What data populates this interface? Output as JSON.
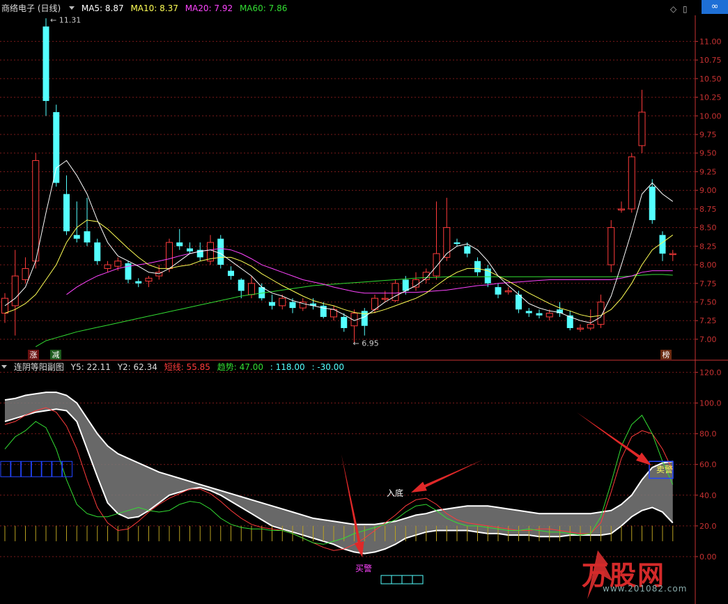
{
  "header": {
    "title": "商络电子 (日线)",
    "ma5": "MA5: 8.87",
    "ma10": "MA10: 8.37",
    "ma20": "MA20: 7.92",
    "ma60": "MA60: 7.86"
  },
  "sub_header": {
    "title": "连阴等阳副图",
    "y5": "Y5: 22.11",
    "y2": "Y2: 62.34",
    "short": "短线: 55.85",
    "trend": "趋势: 47.00",
    "v118": ": 118.00",
    "vneg30": ": -30.00"
  },
  "annotations": {
    "high_label": "11.31",
    "low_label": "6.95",
    "zhang": "涨",
    "jian": "减",
    "bang": "榜",
    "rudi": "入底",
    "maijing": "买警",
    "maijing_sell": "卖警"
  },
  "logo": {
    "icon": "link-icon",
    "text": "∞"
  },
  "watermark": {
    "brand": "万股网",
    "url": "www.201082.com"
  },
  "colors": {
    "up": "#ff3b3b",
    "down": "#54ffff",
    "ma5": "#ffffff",
    "ma10": "#ffff55",
    "ma20": "#ff44ff",
    "ma60": "#33dd33",
    "grid": "#7a1a1a",
    "axis": "#c83232"
  },
  "chart_data": [
    {
      "type": "candlestick",
      "title": "商络电子 (日线)",
      "ylim": [
        6.85,
        11.35
      ],
      "yticks": [
        "11.00",
        "10.75",
        "10.50",
        "10.25",
        "10.00",
        "9.75",
        "9.50",
        "9.25",
        "9.00",
        "8.75",
        "8.50",
        "8.25",
        "8.00",
        "7.75",
        "7.50",
        "7.25",
        "7.00"
      ],
      "candles": [
        [
          7.35,
          7.55,
          7.22,
          7.62
        ],
        [
          7.45,
          7.85,
          7.05,
          8.2
        ],
        [
          7.8,
          7.95,
          7.75,
          8.1
        ],
        [
          8.05,
          9.4,
          7.95,
          9.5
        ],
        [
          11.2,
          10.2,
          10.0,
          11.31
        ],
        [
          10.05,
          9.1,
          9.05,
          10.15
        ],
        [
          8.95,
          8.45,
          8.4,
          9.2
        ],
        [
          8.4,
          8.35,
          8.3,
          8.85
        ],
        [
          8.45,
          8.3,
          8.25,
          8.9
        ],
        [
          8.3,
          8.05,
          8.0,
          8.35
        ],
        [
          7.95,
          8.0,
          7.9,
          8.05
        ],
        [
          7.98,
          8.05,
          7.92,
          8.1
        ],
        [
          8.02,
          7.8,
          7.75,
          8.05
        ],
        [
          7.78,
          7.75,
          7.7,
          7.82
        ],
        [
          7.78,
          7.82,
          7.7,
          7.85
        ],
        [
          7.85,
          7.9,
          7.8,
          8.0
        ],
        [
          7.95,
          8.3,
          7.9,
          8.35
        ],
        [
          8.3,
          8.25,
          8.2,
          8.48
        ],
        [
          8.22,
          8.18,
          8.15,
          8.3
        ],
        [
          8.2,
          8.1,
          8.05,
          8.3
        ],
        [
          8.05,
          8.3,
          8.0,
          8.4
        ],
        [
          8.35,
          8.0,
          7.95,
          8.4
        ],
        [
          7.92,
          7.85,
          7.8,
          7.98
        ],
        [
          7.8,
          7.65,
          7.55,
          7.82
        ],
        [
          7.6,
          7.75,
          7.55,
          7.85
        ],
        [
          7.7,
          7.55,
          7.52,
          7.75
        ],
        [
          7.5,
          7.45,
          7.4,
          7.6
        ],
        [
          7.45,
          7.55,
          7.4,
          7.6
        ],
        [
          7.5,
          7.42,
          7.35,
          7.55
        ],
        [
          7.42,
          7.5,
          7.38,
          7.55
        ],
        [
          7.48,
          7.45,
          7.4,
          7.55
        ],
        [
          7.45,
          7.3,
          7.28,
          7.5
        ],
        [
          7.3,
          7.4,
          7.25,
          7.45
        ],
        [
          7.3,
          7.15,
          7.1,
          7.35
        ],
        [
          7.18,
          7.35,
          6.95,
          7.4
        ],
        [
          7.38,
          7.18,
          7.05,
          7.42
        ],
        [
          7.4,
          7.55,
          7.35,
          7.6
        ],
        [
          7.55,
          7.55,
          7.5,
          7.65
        ],
        [
          7.52,
          7.75,
          7.5,
          7.8
        ],
        [
          7.8,
          7.65,
          7.6,
          7.85
        ],
        [
          7.7,
          7.8,
          7.65,
          7.9
        ],
        [
          7.8,
          7.9,
          7.75,
          7.95
        ],
        [
          7.85,
          8.15,
          7.8,
          8.85
        ],
        [
          8.1,
          8.5,
          8.05,
          8.9
        ],
        [
          8.3,
          8.28,
          8.25,
          8.35
        ],
        [
          8.25,
          8.15,
          8.1,
          8.3
        ],
        [
          8.05,
          7.9,
          7.85,
          8.1
        ],
        [
          7.95,
          7.75,
          7.7,
          8.0
        ],
        [
          7.7,
          7.6,
          7.55,
          7.75
        ],
        [
          7.65,
          7.65,
          7.6,
          7.7
        ],
        [
          7.6,
          7.4,
          7.35,
          7.65
        ],
        [
          7.38,
          7.35,
          7.3,
          7.42
        ],
        [
          7.35,
          7.32,
          7.28,
          7.4
        ],
        [
          7.3,
          7.35,
          7.25,
          7.4
        ],
        [
          7.4,
          7.35,
          7.3,
          7.5
        ],
        [
          7.32,
          7.15,
          7.12,
          7.38
        ],
        [
          7.15,
          7.15,
          7.1,
          7.2
        ],
        [
          7.15,
          7.2,
          7.12,
          7.4
        ],
        [
          7.2,
          7.5,
          7.15,
          7.6
        ],
        [
          8.0,
          8.5,
          7.9,
          8.6
        ],
        [
          8.75,
          8.75,
          8.7,
          8.85
        ],
        [
          8.75,
          9.45,
          8.7,
          9.5
        ],
        [
          9.6,
          10.05,
          9.5,
          10.35
        ],
        [
          9.05,
          8.6,
          8.55,
          9.15
        ],
        [
          8.4,
          8.15,
          8.05,
          8.45
        ],
        [
          8.15,
          8.15,
          8.05,
          8.2
        ]
      ],
      "ma5": [
        7.45,
        7.55,
        7.7,
        8.05,
        8.7,
        9.3,
        9.4,
        9.2,
        8.95,
        8.6,
        8.3,
        8.12,
        8.05,
        7.98,
        7.9,
        7.88,
        7.95,
        8.05,
        8.15,
        8.18,
        8.2,
        8.15,
        8.05,
        7.95,
        7.85,
        7.7,
        7.62,
        7.58,
        7.52,
        7.48,
        7.45,
        7.42,
        7.4,
        7.33,
        7.25,
        7.3,
        7.4,
        7.5,
        7.58,
        7.65,
        7.72,
        7.82,
        7.98,
        8.15,
        8.25,
        8.28,
        8.2,
        8.05,
        7.85,
        7.72,
        7.6,
        7.48,
        7.42,
        7.38,
        7.36,
        7.3,
        7.25,
        7.22,
        7.3,
        7.58,
        8.0,
        8.45,
        8.95,
        9.1,
        8.95,
        8.85
      ],
      "ma10": [
        7.35,
        7.4,
        7.48,
        7.6,
        7.8,
        8.0,
        8.3,
        8.5,
        8.6,
        8.58,
        8.48,
        8.35,
        8.22,
        8.1,
        8.0,
        7.95,
        7.95,
        7.98,
        8.0,
        8.05,
        8.08,
        8.1,
        8.1,
        8.05,
        7.98,
        7.88,
        7.8,
        7.72,
        7.65,
        7.58,
        7.52,
        7.48,
        7.45,
        7.4,
        7.36,
        7.34,
        7.36,
        7.4,
        7.45,
        7.5,
        7.55,
        7.62,
        7.72,
        7.82,
        7.9,
        7.95,
        7.95,
        7.92,
        7.85,
        7.78,
        7.7,
        7.62,
        7.55,
        7.48,
        7.42,
        7.38,
        7.33,
        7.3,
        7.32,
        7.4,
        7.55,
        7.75,
        8.0,
        8.2,
        8.3,
        8.4
      ],
      "ma20": [
        null,
        null,
        null,
        null,
        null,
        null,
        7.6,
        7.7,
        7.78,
        7.85,
        7.9,
        7.95,
        7.98,
        8.0,
        8.02,
        8.05,
        8.08,
        8.12,
        8.15,
        8.18,
        8.2,
        8.22,
        8.2,
        8.15,
        8.08,
        8.0,
        7.95,
        7.9,
        7.85,
        7.8,
        7.77,
        7.74,
        7.7,
        7.67,
        7.64,
        7.62,
        7.62,
        7.62,
        7.62,
        7.63,
        7.63,
        7.64,
        7.65,
        7.66,
        7.68,
        7.7,
        7.72,
        7.73,
        7.75,
        7.76,
        7.77,
        7.78,
        7.79,
        7.8,
        7.8,
        7.8,
        7.8,
        7.8,
        7.8,
        7.8,
        7.82,
        7.85,
        7.9,
        7.92,
        7.92,
        7.92
      ],
      "ma60": [
        null,
        null,
        null,
        6.9,
        6.98,
        7.02,
        7.06,
        7.1,
        7.13,
        7.16,
        7.19,
        7.22,
        7.25,
        7.28,
        7.31,
        7.34,
        7.37,
        7.4,
        7.43,
        7.46,
        7.49,
        7.52,
        7.55,
        7.58,
        7.6,
        7.62,
        7.64,
        7.66,
        7.68,
        7.7,
        7.72,
        7.73,
        7.74,
        7.75,
        7.76,
        7.77,
        7.78,
        7.79,
        7.8,
        7.81,
        7.82,
        7.83,
        7.83,
        7.84,
        7.84,
        7.84,
        7.84,
        7.84,
        7.84,
        7.84,
        7.84,
        7.84,
        7.84,
        7.84,
        7.84,
        7.84,
        7.84,
        7.84,
        7.84,
        7.84,
        7.84,
        7.85,
        7.86,
        7.87,
        7.87,
        7.86
      ]
    },
    {
      "type": "line",
      "title": "连阴等阳副图",
      "ylim": [
        -5,
        122
      ],
      "yticks": [
        "120.0",
        "100.0",
        "80.0",
        "60.0",
        "40.0",
        "20.0",
        "0.00"
      ],
      "series": [
        {
          "name": "Y2",
          "values": [
            102,
            103,
            105,
            106,
            107,
            107,
            105,
            100,
            90,
            80,
            72,
            67,
            64,
            61,
            58,
            55,
            53,
            51,
            49,
            47,
            45,
            43,
            41,
            39,
            37,
            35,
            33,
            31,
            29,
            27,
            25,
            24,
            23,
            22,
            21,
            21,
            21,
            22,
            23,
            25,
            27,
            28,
            30,
            31,
            32,
            33,
            33,
            33,
            32,
            31,
            30,
            29,
            28,
            28,
            28,
            28,
            28,
            28,
            29,
            30,
            34,
            40,
            50,
            58,
            61,
            62
          ]
        },
        {
          "name": "Y5",
          "values": [
            88,
            90,
            92,
            94,
            95,
            96,
            95,
            88,
            70,
            52,
            35,
            28,
            25,
            26,
            30,
            35,
            40,
            42,
            44,
            45,
            43,
            40,
            36,
            32,
            28,
            24,
            20,
            18,
            16,
            14,
            12,
            10,
            8,
            5,
            3,
            2,
            3,
            5,
            8,
            12,
            14,
            16,
            17,
            17,
            17,
            17,
            16,
            15,
            15,
            14,
            14,
            14,
            13,
            13,
            13,
            14,
            14,
            14,
            14,
            15,
            20,
            26,
            30,
            32,
            29,
            22
          ]
        },
        {
          "name": "短线",
          "values": [
            86,
            88,
            92,
            95,
            97,
            94,
            85,
            70,
            50,
            32,
            22,
            17,
            18,
            23,
            29,
            34,
            38,
            41,
            44,
            44,
            41,
            36,
            30,
            25,
            21,
            19,
            18,
            17,
            15,
            12,
            9,
            6,
            4,
            5,
            8,
            12,
            17,
            22,
            27,
            33,
            37,
            38,
            34,
            28,
            24,
            22,
            21,
            20,
            19,
            18,
            17,
            17,
            18,
            18,
            17,
            16,
            15,
            15,
            22,
            42,
            64,
            78,
            82,
            80,
            70,
            56
          ]
        },
        {
          "name": "趋势",
          "values": [
            70,
            78,
            82,
            88,
            84,
            70,
            50,
            34,
            28,
            26,
            26,
            28,
            30,
            32,
            30,
            29,
            30,
            34,
            36,
            35,
            31,
            25,
            21,
            19,
            18,
            18,
            17,
            17,
            15,
            12,
            9,
            8,
            10,
            12,
            15,
            17,
            19,
            21,
            24,
            29,
            33,
            34,
            30,
            25,
            22,
            20,
            20,
            19,
            18,
            17,
            17,
            18,
            17,
            16,
            16,
            15,
            14,
            15,
            26,
            48,
            72,
            86,
            92,
            80,
            62,
            47
          ]
        }
      ]
    }
  ]
}
